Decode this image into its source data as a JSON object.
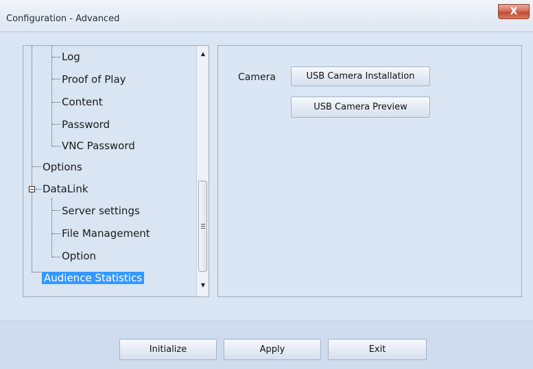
{
  "window": {
    "title": "Configuration - Advanced",
    "close_label": "X"
  },
  "tree": {
    "items": [
      {
        "label": "Log"
      },
      {
        "label": "Proof of Play"
      },
      {
        "label": "Content"
      },
      {
        "label": "Password"
      },
      {
        "label": "VNC Password"
      },
      {
        "label": "Options"
      },
      {
        "label": "DataLink"
      },
      {
        "label": "Server settings"
      },
      {
        "label": "File Management"
      },
      {
        "label": "Option"
      },
      {
        "label": "Audience Statistics",
        "selected": true
      }
    ]
  },
  "content": {
    "camera_label": "Camera",
    "install_button": "USB Camera Installation",
    "preview_button": "USB Camera Preview"
  },
  "footer": {
    "initialize": "Initialize",
    "apply": "Apply",
    "exit": "Exit"
  },
  "colors": {
    "selection": "#3399ff",
    "close_button": "#c24a35",
    "window_bg": "#dbe6f4"
  }
}
